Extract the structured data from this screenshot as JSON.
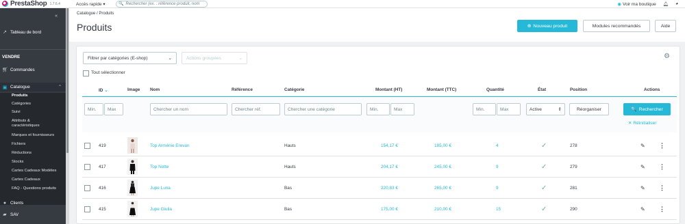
{
  "brand": {
    "name": "PrestaShop",
    "version": "1.7.6.4"
  },
  "topbar": {
    "quick_access": "Accès rapide",
    "search_placeholder": "Rechercher (ex. : référence produit, nom",
    "view_shop": "Voir ma boutique"
  },
  "sidebar": {
    "collapse": "«",
    "dashboard": "Tableau de bord",
    "section": "VENDRE",
    "orders": "Commandes",
    "catalog": "Catalogue",
    "catalog_links": [
      "Produits",
      "Catégories",
      "Suivi",
      "Attributs &",
      "caractéristiques",
      "Marques et fournisseurs",
      "Fichiers",
      "Réductions",
      "Stocks",
      "Cartes Cadeaux Modèles",
      "Cartes Cadeaux",
      "FAQ - Questions produits"
    ],
    "clients": "Clients",
    "sav": "SAV"
  },
  "header": {
    "breadcrumb": "Catalogue  /  Produits",
    "title": "Produits",
    "new_product": "Nouveau produit",
    "recommended": "Modules recommandés",
    "help": "Aide"
  },
  "toolbar": {
    "filter_categories": "Filtrer par catégories (E-shop)",
    "bulk_actions": "Actions groupées",
    "select_all": "Tout sélectionner"
  },
  "table": {
    "headers": {
      "id": "ID",
      "image": "Image",
      "name": "Nom",
      "reference": "Référence",
      "category": "Catégorie",
      "amount_ht": "Montant (HT)",
      "amount_ttc": "Montant (TTC)",
      "quantity": "Quantité",
      "state": "État",
      "position": "Position",
      "actions": "Actions"
    },
    "filters": {
      "min": "Min.",
      "max": "Max",
      "name": "Chercher un nom",
      "reference": "Chercher réf.",
      "category": "Chercher une catégorie",
      "state": "Active",
      "reorganize": "Réorganiser",
      "search": "Rechercher",
      "reset": "Réinitialiser"
    },
    "rows": [
      {
        "id": "419",
        "name": "Top Arménie Erevan",
        "category": "Hauts",
        "ht": "154,17 €",
        "ttc": "185,00 €",
        "qty": "4",
        "position": "278",
        "image": "white top"
      },
      {
        "id": "417",
        "name": "Top Notte",
        "category": "Hauts",
        "ht": "204,17 €",
        "ttc": "245,00 €",
        "qty": "9",
        "position": "279",
        "image": "black top"
      },
      {
        "id": "416",
        "name": "Jupe Luna",
        "category": "Bas",
        "ht": "220,83 €",
        "ttc": "265,00 €",
        "qty": "9",
        "position": "281",
        "image": "black skirt"
      },
      {
        "id": "415",
        "name": "Jupe Giulia",
        "category": "Bas",
        "ht": "175,00 €",
        "ttc": "210,00 €",
        "qty": "15",
        "position": "290",
        "image": "black skirt"
      }
    ]
  },
  "colors": {
    "accent": "#25b9d7",
    "sidebar": "#363a41",
    "success": "#70b580"
  }
}
